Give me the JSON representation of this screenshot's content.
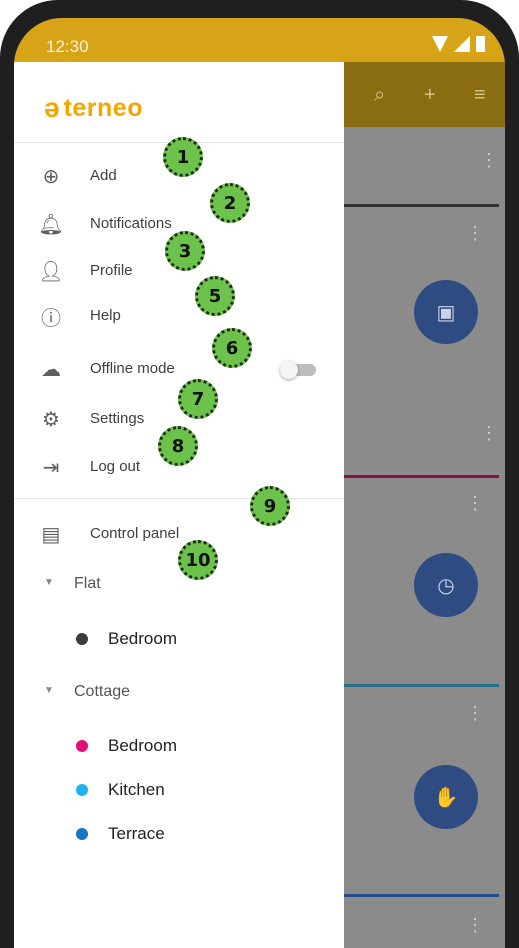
{
  "status": {
    "time": "12:30"
  },
  "drawer": {
    "logo": "terneo",
    "menu": [
      {
        "label": "Add",
        "icon": "add-circle-icon"
      },
      {
        "label": "Notifications",
        "icon": "bell-icon"
      },
      {
        "label": "Profile",
        "icon": "person-icon"
      },
      {
        "label": "Help",
        "icon": "help-circle-icon"
      },
      {
        "label": "Offline mode",
        "icon": "cloud-off-icon",
        "toggle": false
      },
      {
        "label": "Settings",
        "icon": "gear-icon"
      },
      {
        "label": "Log out",
        "icon": "logout-icon"
      }
    ],
    "control_panel": {
      "label": "Control panel",
      "icon": "monitor-icon"
    },
    "groups": [
      {
        "label": "Flat",
        "rooms": [
          {
            "label": "Bedroom",
            "color": "#3c3c3c"
          }
        ]
      },
      {
        "label": "Cottage",
        "rooms": [
          {
            "label": "Bedroom",
            "color": "#e0107a"
          },
          {
            "label": "Kitchen",
            "color": "#1fb3f0"
          },
          {
            "label": "Terrace",
            "color": "#1773c4"
          }
        ]
      }
    ]
  },
  "badges": [
    "1",
    "2",
    "3",
    "5",
    "6",
    "7",
    "8",
    "9",
    "10"
  ],
  "colors": {
    "accent": "#f4a600",
    "statusbar": "#d8a417",
    "badge": "#6dc24b"
  }
}
